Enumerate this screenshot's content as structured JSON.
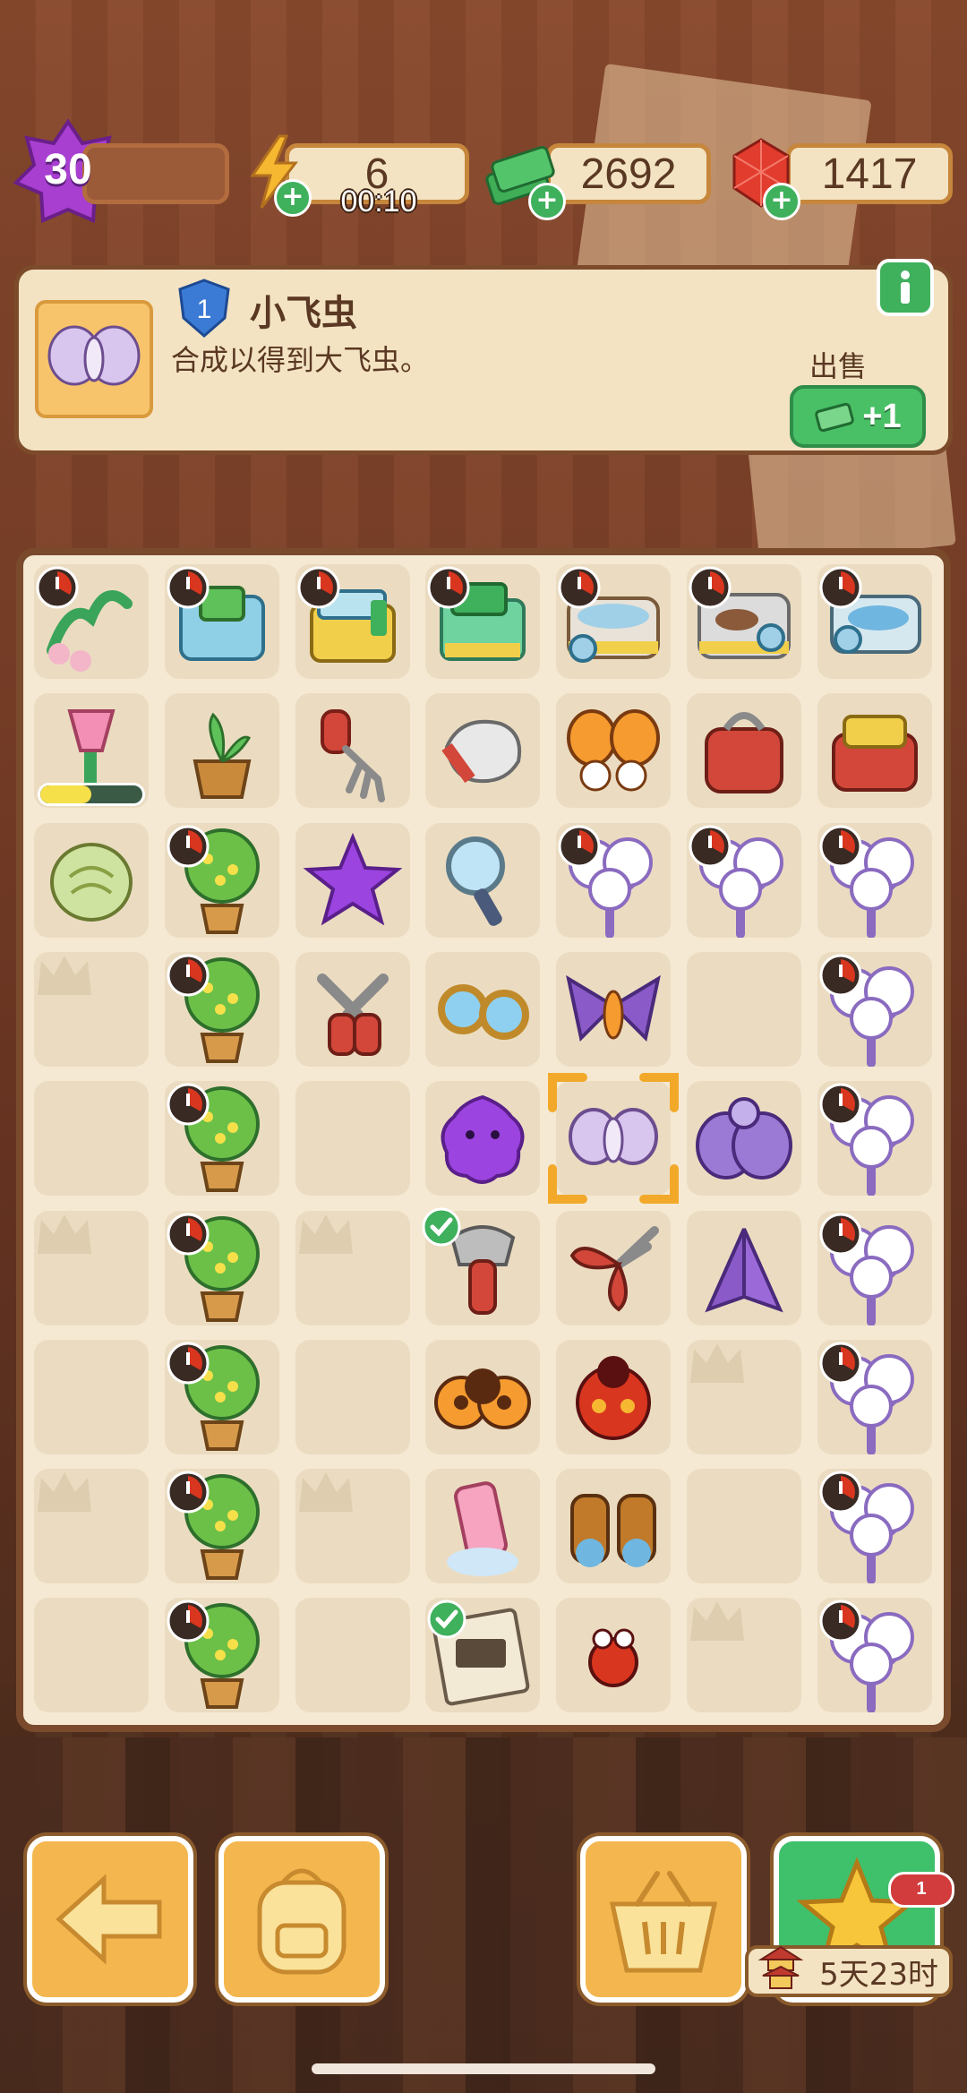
{
  "hud": {
    "level": "30",
    "energy": "6",
    "energy_timer": "00:10",
    "cash": "2692",
    "gems": "1417"
  },
  "item_info": {
    "level_badge": "1",
    "name": "小飞虫",
    "description": "合成以得到大飞虫。",
    "sell_label": "出售",
    "sell_value": "+1"
  },
  "board": {
    "columns": 7,
    "rows": 9,
    "cells": [
      [
        "frog-toy",
        "box-blue",
        "box-yellow",
        "box-green",
        "tub-dirty",
        "tub-grey",
        "tub-blue"
      ],
      [
        "paintbrush",
        "potted-sprout",
        "rake",
        "glove",
        "butterfly-orange",
        "red-bag",
        "red-bag-sparkle"
      ],
      [
        "egg",
        "tree-yellow",
        "star-purple",
        "magnifier",
        "cotton-tree",
        "cotton-tree",
        "cotton-tree"
      ],
      [
        "empty-crown",
        "tree-yellow",
        "pruner",
        "goggles",
        "moth-purple",
        "empty",
        "cotton-tree"
      ],
      [
        "empty",
        "tree-yellow",
        "empty",
        "purple-blob",
        "moth-small-selected",
        "moth-big",
        "cotton-tree"
      ],
      [
        "empty-crown",
        "tree-yellow",
        "empty-crown",
        "axe",
        "shears",
        "moth-wings",
        "cotton-tree"
      ],
      [
        "empty",
        "tree-yellow",
        "empty",
        "ladybug-orange",
        "ladybug-red",
        "empty-crown",
        "cotton-tree"
      ],
      [
        "empty-crown",
        "tree-yellow",
        "empty-crown",
        "lotion",
        "binoculars",
        "empty",
        "cotton-tree"
      ],
      [
        "empty",
        "tree-yellow",
        "empty",
        "coupon",
        "ladybug-small",
        "empty-crown",
        "cotton-tree"
      ]
    ],
    "progress_bar_fill": 0.5
  },
  "bottom_bar": {
    "event_timer": "5天23时",
    "event_notification": "1"
  },
  "colors": {
    "panel": "#f3e3c2",
    "accent_green": "#3fb05c",
    "button_orange": "#f4b64e",
    "wood": "#7a4a2c"
  }
}
